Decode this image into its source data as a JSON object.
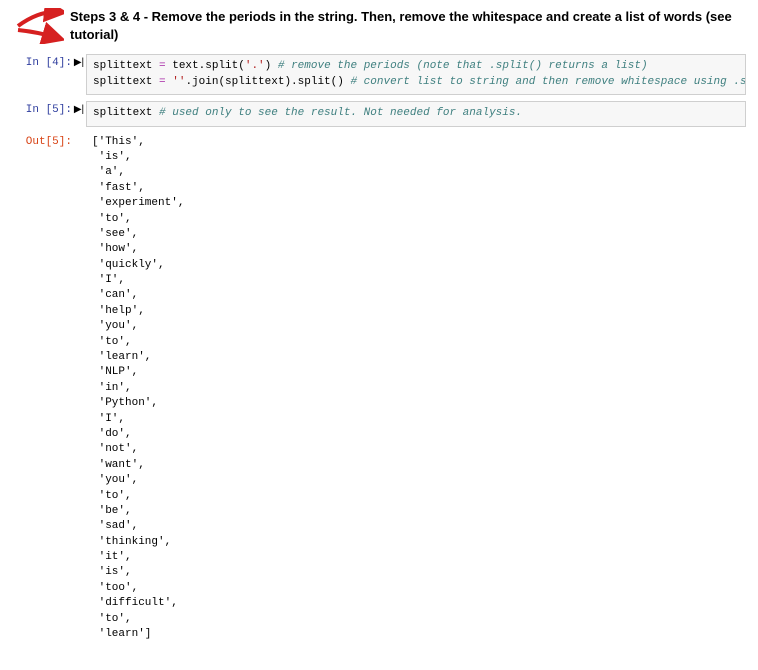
{
  "heading": "Steps 3 & 4 - Remove the periods in the string. Then, remove the whitespace and create a list of words (see tutorial)",
  "cell4": {
    "prompt": "In [4]:",
    "line1": {
      "lhs": "splittext",
      "eq": " = ",
      "rhs": "text.split(",
      "arg": "'.'",
      "close": ")",
      "comment": " # remove the periods (note that .split() returns a list)"
    },
    "line2": {
      "lhs": "splittext",
      "eq": " = ",
      "str": "''",
      "mid": ".join(splittext).split()",
      "comment": " # convert list to string and then remove whitespace using .split()"
    }
  },
  "cell5": {
    "prompt": "In [5]:",
    "code_lhs": "splittext",
    "code_comment": " # used only to see the result. Not needed for analysis.",
    "out_prompt": "Out[5]:",
    "output": "['This',\n 'is',\n 'a',\n 'fast',\n 'experiment',\n 'to',\n 'see',\n 'how',\n 'quickly',\n 'I',\n 'can',\n 'help',\n 'you',\n 'to',\n 'learn',\n 'NLP',\n 'in',\n 'Python',\n 'I',\n 'do',\n 'not',\n 'want',\n 'you',\n 'to',\n 'be',\n 'sad',\n 'thinking',\n 'it',\n 'is',\n 'too',\n 'difficult',\n 'to',\n 'learn']"
  }
}
